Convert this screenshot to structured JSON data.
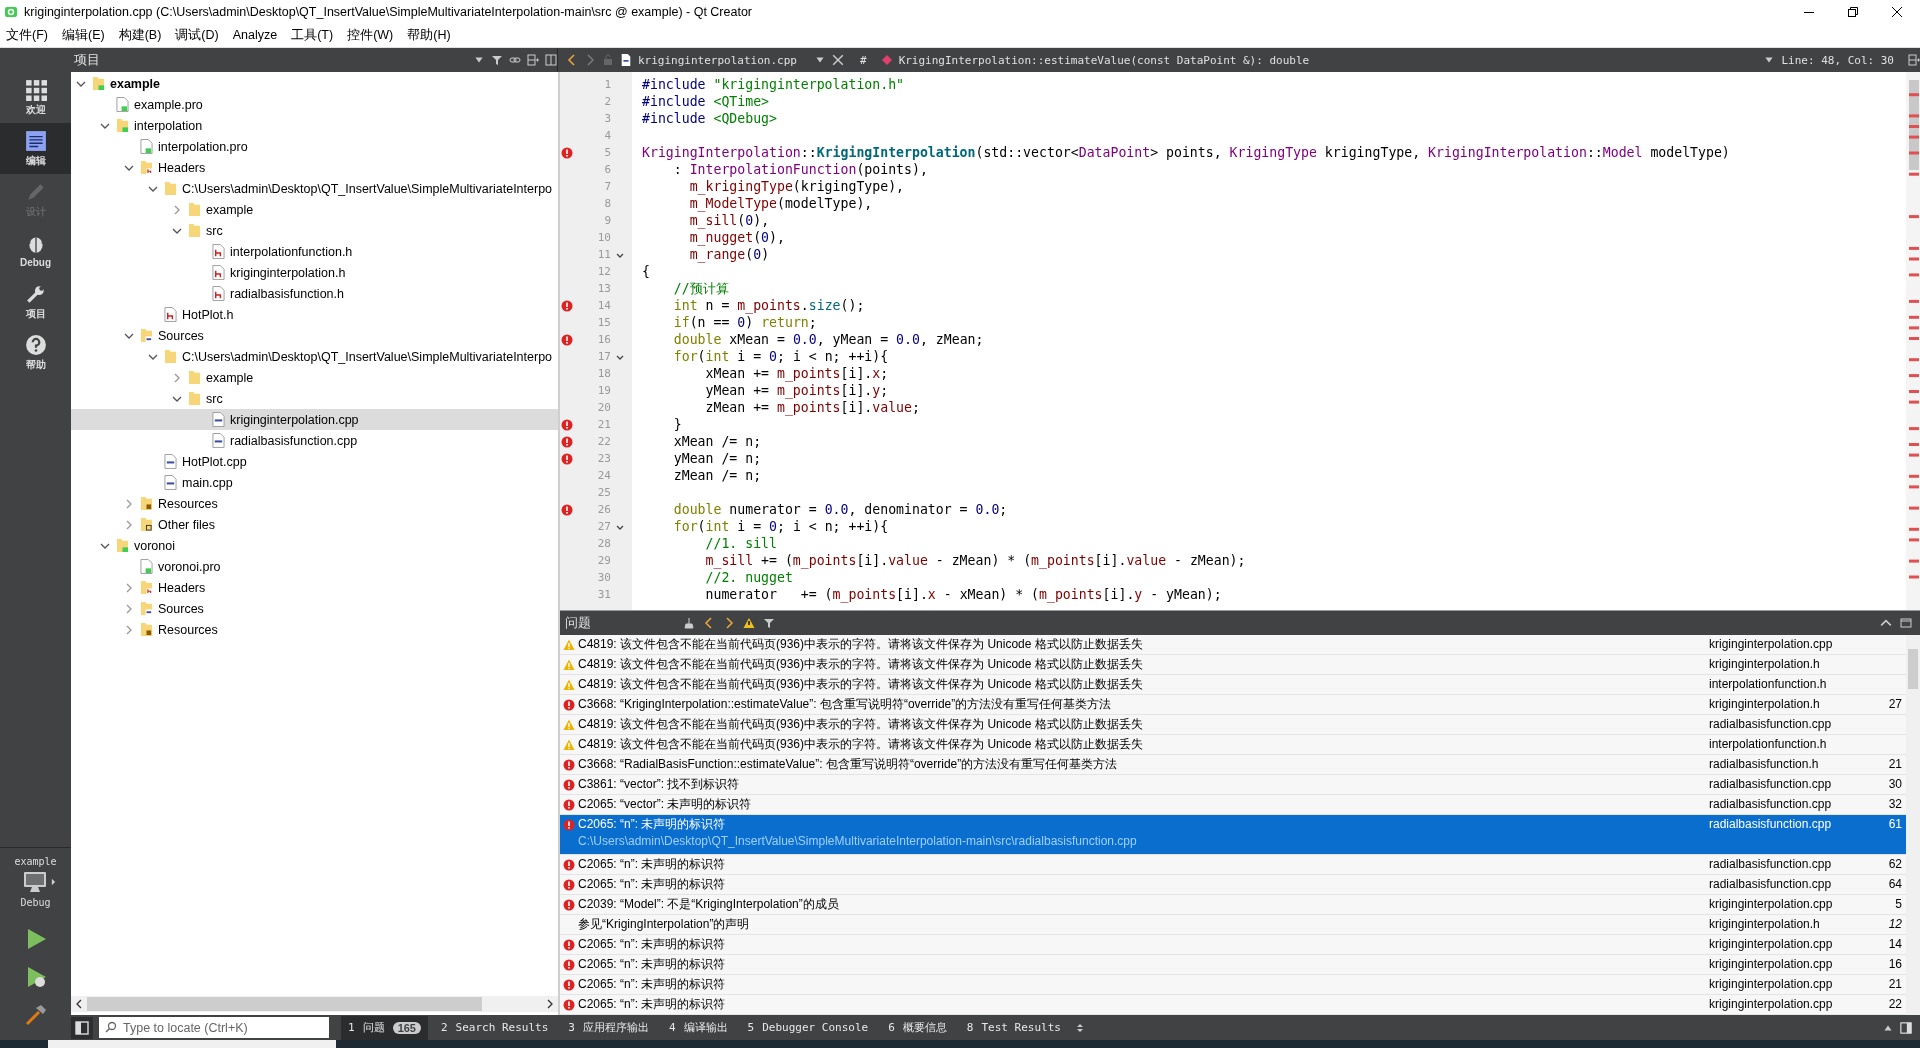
{
  "window": {
    "title": "kriginginterpolation.cpp (C:\\Users\\admin\\Desktop\\QT_InsertValue\\SimpleMultivariateInterpolation-main\\src @ example) - Qt Creator"
  },
  "menu": [
    "文件(F)",
    "编辑(E)",
    "构建(B)",
    "调试(D)",
    "Analyze",
    "工具(T)",
    "控件(W)",
    "帮助(H)"
  ],
  "modes": [
    {
      "label": "欢迎",
      "kind": "welcome",
      "selected": false,
      "disabled": false
    },
    {
      "label": "编辑",
      "kind": "edit",
      "selected": true,
      "disabled": false
    },
    {
      "label": "设计",
      "kind": "design",
      "selected": false,
      "disabled": true
    },
    {
      "label": "Debug",
      "kind": "debug",
      "selected": false,
      "disabled": false
    },
    {
      "label": "项目",
      "kind": "projects",
      "selected": false,
      "disabled": false
    },
    {
      "label": "帮助",
      "kind": "help",
      "selected": false,
      "disabled": false
    }
  ],
  "kit": {
    "project": "example",
    "build": "Debug"
  },
  "project_pane": {
    "title": "项目"
  },
  "tree": [
    {
      "label": "example",
      "kind": "project",
      "bold": true,
      "selected": false,
      "expanded": true,
      "children": [
        {
          "label": "example.pro",
          "kind": "pro",
          "selected": false
        },
        {
          "label": "interpolation",
          "kind": "project",
          "selected": false,
          "expanded": true,
          "children": [
            {
              "label": "interpolation.pro",
              "kind": "pro",
              "selected": false
            },
            {
              "label": "Headers",
              "kind": "header-folder",
              "selected": false,
              "expanded": true,
              "children": [
                {
                  "label": "C:\\Users\\admin\\Desktop\\QT_InsertValue\\SimpleMultivariateInterpo",
                  "kind": "folder",
                  "selected": false,
                  "expanded": true,
                  "children": [
                    {
                      "label": "example",
                      "kind": "folder",
                      "selected": false,
                      "expanded": false
                    },
                    {
                      "label": "src",
                      "kind": "folder",
                      "selected": false,
                      "expanded": true,
                      "children": [
                        {
                          "label": "interpolationfunction.h",
                          "kind": "h",
                          "selected": false
                        },
                        {
                          "label": "kriginginterpolation.h",
                          "kind": "h",
                          "selected": false
                        },
                        {
                          "label": "radialbasisfunction.h",
                          "kind": "h",
                          "selected": false
                        }
                      ]
                    }
                  ]
                },
                {
                  "label": "HotPlot.h",
                  "kind": "h",
                  "selected": false
                }
              ]
            },
            {
              "label": "Sources",
              "kind": "source-folder",
              "selected": false,
              "expanded": true,
              "children": [
                {
                  "label": "C:\\Users\\admin\\Desktop\\QT_InsertValue\\SimpleMultivariateInterpo",
                  "kind": "folder",
                  "selected": false,
                  "expanded": true,
                  "children": [
                    {
                      "label": "example",
                      "kind": "folder",
                      "selected": false,
                      "expanded": false
                    },
                    {
                      "label": "src",
                      "kind": "folder",
                      "selected": false,
                      "expanded": true,
                      "children": [
                        {
                          "label": "kriginginterpolation.cpp",
                          "kind": "cpp",
                          "selected": true
                        },
                        {
                          "label": "radialbasisfunction.cpp",
                          "kind": "cpp",
                          "selected": false
                        }
                      ]
                    }
                  ]
                },
                {
                  "label": "HotPlot.cpp",
                  "kind": "cpp",
                  "selected": false
                },
                {
                  "label": "main.cpp",
                  "kind": "cpp",
                  "selected": false
                }
              ]
            },
            {
              "label": "Resources",
              "kind": "resource-folder",
              "selected": false,
              "expanded": false
            },
            {
              "label": "Other files",
              "kind": "other-folder",
              "selected": false,
              "expanded": false
            }
          ]
        },
        {
          "label": "voronoi",
          "kind": "project",
          "selected": false,
          "expanded": true,
          "children": [
            {
              "label": "voronoi.pro",
              "kind": "pro",
              "selected": false
            },
            {
              "label": "Headers",
              "kind": "header-folder",
              "selected": false,
              "expanded": false
            },
            {
              "label": "Sources",
              "kind": "source-folder",
              "selected": false,
              "expanded": false
            },
            {
              "label": "Resources",
              "kind": "resource-folder",
              "selected": false,
              "expanded": false
            }
          ]
        }
      ]
    }
  ],
  "editor_toolbar": {
    "file": "kriginginterpolation.cpp",
    "hash": "#",
    "symbol": "KrigingInterpolation::estimateValue(const DataPoint &): double",
    "position": "Line: 48, Col: 30"
  },
  "code": [
    {
      "n": "1",
      "segs": [
        {
          "kind": "pp",
          "text": "#include "
        },
        {
          "kind": "str",
          "text": "\"kriginginterpolation.h\""
        }
      ]
    },
    {
      "n": "2",
      "segs": [
        {
          "kind": "pp",
          "text": "#include "
        },
        {
          "kind": "str",
          "text": "<QTime>"
        }
      ]
    },
    {
      "n": "3",
      "segs": [
        {
          "kind": "pp",
          "text": "#include "
        },
        {
          "kind": "str",
          "text": "<QDebug>"
        }
      ]
    },
    {
      "n": "4"
    },
    {
      "n": "5",
      "error": true,
      "segs": [
        {
          "kind": "type",
          "text": "KrigingInterpolation"
        },
        {
          "kind": "p",
          "text": "::"
        },
        {
          "kind": "bold",
          "text": "KrigingInterpolation"
        },
        {
          "kind": "p",
          "text": "(std::vector<"
        },
        {
          "kind": "type",
          "text": "DataPoint"
        },
        {
          "kind": "p",
          "text": "> points, "
        },
        {
          "kind": "type",
          "text": "KrigingType"
        },
        {
          "kind": "p",
          "text": " krigingType, "
        },
        {
          "kind": "type",
          "text": "KrigingInterpolation"
        },
        {
          "kind": "p",
          "text": "::"
        },
        {
          "kind": "type",
          "text": "Model"
        },
        {
          "kind": "p",
          "text": " modelType)"
        }
      ]
    },
    {
      "n": "6",
      "segs": [
        {
          "kind": "p",
          "text": "    : "
        },
        {
          "kind": "type",
          "text": "InterpolationFunction"
        },
        {
          "kind": "p",
          "text": "(points),"
        }
      ]
    },
    {
      "n": "7",
      "segs": [
        {
          "kind": "field",
          "text": "      m_krigingType"
        },
        {
          "kind": "p",
          "text": "(krigingType),"
        }
      ]
    },
    {
      "n": "8",
      "segs": [
        {
          "kind": "field",
          "text": "      m_ModelType"
        },
        {
          "kind": "p",
          "text": "(modelType),"
        }
      ]
    },
    {
      "n": "9",
      "segs": [
        {
          "kind": "field",
          "text": "      m_sill"
        },
        {
          "kind": "p",
          "text": "("
        },
        {
          "kind": "num",
          "text": "0"
        },
        {
          "kind": "p",
          "text": "),"
        }
      ]
    },
    {
      "n": "10",
      "segs": [
        {
          "kind": "field",
          "text": "      m_nugget"
        },
        {
          "kind": "p",
          "text": "("
        },
        {
          "kind": "num",
          "text": "0"
        },
        {
          "kind": "p",
          "text": "),"
        }
      ]
    },
    {
      "n": "11",
      "fold": true,
      "segs": [
        {
          "kind": "field",
          "text": "      m_range"
        },
        {
          "kind": "p",
          "text": "("
        },
        {
          "kind": "num",
          "text": "0"
        },
        {
          "kind": "p",
          "text": ")"
        }
      ]
    },
    {
      "n": "12",
      "segs": [
        {
          "kind": "p",
          "text": "{"
        }
      ]
    },
    {
      "n": "13",
      "segs": [
        {
          "kind": "cm",
          "text": "    //预计算"
        }
      ]
    },
    {
      "n": "14",
      "error": true,
      "segs": [
        {
          "kind": "kw",
          "text": "    int"
        },
        {
          "kind": "p",
          "text": " n = "
        },
        {
          "kind": "field",
          "text": "m_points"
        },
        {
          "kind": "p",
          "text": "."
        },
        {
          "kind": "fn",
          "text": "size"
        },
        {
          "kind": "p",
          "text": "();"
        }
      ]
    },
    {
      "n": "15",
      "segs": [
        {
          "kind": "kw",
          "text": "    if"
        },
        {
          "kind": "p",
          "text": "(n == "
        },
        {
          "kind": "num",
          "text": "0"
        },
        {
          "kind": "p",
          "text": ") "
        },
        {
          "kind": "kw",
          "text": "return"
        },
        {
          "kind": "p",
          "text": ";"
        }
      ]
    },
    {
      "n": "16",
      "error": true,
      "segs": [
        {
          "kind": "kw",
          "text": "    double"
        },
        {
          "kind": "p",
          "text": " xMean = "
        },
        {
          "kind": "num",
          "text": "0.0"
        },
        {
          "kind": "p",
          "text": ", yMean = "
        },
        {
          "kind": "num",
          "text": "0.0"
        },
        {
          "kind": "p",
          "text": ", zMean;"
        }
      ]
    },
    {
      "n": "17",
      "fold": true,
      "segs": [
        {
          "kind": "kw",
          "text": "    for"
        },
        {
          "kind": "p",
          "text": "("
        },
        {
          "kind": "kw",
          "text": "int"
        },
        {
          "kind": "p",
          "text": " i = "
        },
        {
          "kind": "num",
          "text": "0"
        },
        {
          "kind": "p",
          "text": "; i < n; ++i){"
        }
      ]
    },
    {
      "n": "18",
      "segs": [
        {
          "kind": "p",
          "text": "        xMean += "
        },
        {
          "kind": "field",
          "text": "m_points"
        },
        {
          "kind": "p",
          "text": "[i]."
        },
        {
          "kind": "field",
          "text": "x"
        },
        {
          "kind": "p",
          "text": ";"
        }
      ]
    },
    {
      "n": "19",
      "segs": [
        {
          "kind": "p",
          "text": "        yMean += "
        },
        {
          "kind": "field",
          "text": "m_points"
        },
        {
          "kind": "p",
          "text": "[i]."
        },
        {
          "kind": "field",
          "text": "y"
        },
        {
          "kind": "p",
          "text": ";"
        }
      ]
    },
    {
      "n": "20",
      "segs": [
        {
          "kind": "p",
          "text": "        zMean += "
        },
        {
          "kind": "field",
          "text": "m_points"
        },
        {
          "kind": "p",
          "text": "[i]."
        },
        {
          "kind": "field",
          "text": "value"
        },
        {
          "kind": "p",
          "text": ";"
        }
      ]
    },
    {
      "n": "21",
      "error": true,
      "segs": [
        {
          "kind": "p",
          "text": "    }"
        }
      ]
    },
    {
      "n": "22",
      "error": true,
      "segs": [
        {
          "kind": "p",
          "text": "    xMean /= n;"
        }
      ]
    },
    {
      "n": "23",
      "error": true,
      "segs": [
        {
          "kind": "p",
          "text": "    yMean /= n;"
        }
      ]
    },
    {
      "n": "24",
      "segs": [
        {
          "kind": "p",
          "text": "    zMean /= n;"
        }
      ]
    },
    {
      "n": "25"
    },
    {
      "n": "26",
      "error": true,
      "segs": [
        {
          "kind": "kw",
          "text": "    double"
        },
        {
          "kind": "p",
          "text": " numerator = "
        },
        {
          "kind": "num",
          "text": "0.0"
        },
        {
          "kind": "p",
          "text": ", denominator = "
        },
        {
          "kind": "num",
          "text": "0.0"
        },
        {
          "kind": "p",
          "text": ";"
        }
      ]
    },
    {
      "n": "27",
      "fold": true,
      "segs": [
        {
          "kind": "kw",
          "text": "    for"
        },
        {
          "kind": "p",
          "text": "("
        },
        {
          "kind": "kw",
          "text": "int"
        },
        {
          "kind": "p",
          "text": " i = "
        },
        {
          "kind": "num",
          "text": "0"
        },
        {
          "kind": "p",
          "text": "; i < n; ++i){"
        }
      ]
    },
    {
      "n": "28",
      "segs": [
        {
          "kind": "cm",
          "text": "        //1. sill"
        }
      ]
    },
    {
      "n": "29",
      "segs": [
        {
          "kind": "field",
          "text": "        m_sill"
        },
        {
          "kind": "p",
          "text": " += ("
        },
        {
          "kind": "field",
          "text": "m_points"
        },
        {
          "kind": "p",
          "text": "[i]."
        },
        {
          "kind": "field",
          "text": "value"
        },
        {
          "kind": "p",
          "text": " - zMean) * ("
        },
        {
          "kind": "field",
          "text": "m_points"
        },
        {
          "kind": "p",
          "text": "[i]."
        },
        {
          "kind": "field",
          "text": "value"
        },
        {
          "kind": "p",
          "text": " - zMean);"
        }
      ]
    },
    {
      "n": "30",
      "segs": [
        {
          "kind": "cm",
          "text": "        //2. nugget"
        }
      ]
    },
    {
      "n": "31",
      "segs": [
        {
          "kind": "p",
          "text": "        numerator   += ("
        },
        {
          "kind": "field",
          "text": "m_points"
        },
        {
          "kind": "p",
          "text": "[i]."
        },
        {
          "kind": "field",
          "text": "x"
        },
        {
          "kind": "p",
          "text": " - xMean) * ("
        },
        {
          "kind": "field",
          "text": "m_points"
        },
        {
          "kind": "p",
          "text": "[i]."
        },
        {
          "kind": "field",
          "text": "y"
        },
        {
          "kind": "p",
          "text": " - yMean);"
        }
      ]
    }
  ],
  "issues": {
    "title": "问题",
    "rows": [
      {
        "kind": "warning",
        "text": "C4819: 该文件包含不能在当前代码页(936)中表示的字符。请将该文件保存为 Unicode 格式以防止数据丢失",
        "file": "kriginginterpolation.cpp",
        "selected": false
      },
      {
        "kind": "warning",
        "text": "C4819: 该文件包含不能在当前代码页(936)中表示的字符。请将该文件保存为 Unicode 格式以防止数据丢失",
        "file": "kriginginterpolation.h",
        "selected": false
      },
      {
        "kind": "warning",
        "text": "C4819: 该文件包含不能在当前代码页(936)中表示的字符。请将该文件保存为 Unicode 格式以防止数据丢失",
        "file": "interpolationfunction.h",
        "selected": false
      },
      {
        "kind": "error",
        "text": "C3668: “KrigingInterpolation::estimateValue”: 包含重写说明符“override”的方法没有重写任何基类方法",
        "file": "kriginginterpolation.h",
        "line": "27",
        "selected": false
      },
      {
        "kind": "warning",
        "text": "C4819: 该文件包含不能在当前代码页(936)中表示的字符。请将该文件保存为 Unicode 格式以防止数据丢失",
        "file": "radialbasisfunction.cpp",
        "selected": false
      },
      {
        "kind": "warning",
        "text": "C4819: 该文件包含不能在当前代码页(936)中表示的字符。请将该文件保存为 Unicode 格式以防止数据丢失",
        "file": "interpolationfunction.h",
        "selected": false
      },
      {
        "kind": "error",
        "text": "C3668: “RadialBasisFunction::estimateValue”: 包含重写说明符“override”的方法没有重写任何基类方法",
        "file": "radialbasisfunction.h",
        "line": "21",
        "selected": false
      },
      {
        "kind": "error",
        "text": "C3861: “vector”: 找不到标识符",
        "file": "radialbasisfunction.cpp",
        "line": "30",
        "selected": false
      },
      {
        "kind": "error",
        "text": "C2065: “vector”: 未声明的标识符",
        "file": "radialbasisfunction.cpp",
        "line": "32",
        "selected": false
      },
      {
        "kind": "error",
        "text": "C2065: “n”: 未声明的标识符",
        "path": "C:\\Users\\admin\\Desktop\\QT_InsertValue\\SimpleMultivariateInterpolation-main\\src\\radialbasisfunction.cpp",
        "file": "radialbasisfunction.cpp",
        "line": "61",
        "selected": true
      },
      {
        "kind": "error",
        "text": "C2065: “n”: 未声明的标识符",
        "file": "radialbasisfunction.cpp",
        "line": "62",
        "selected": false
      },
      {
        "kind": "error",
        "text": "C2065: “n”: 未声明的标识符",
        "file": "radialbasisfunction.cpp",
        "line": "64",
        "selected": false
      },
      {
        "kind": "error",
        "text": "C2039: “Model”: 不是“KrigingInterpolation”的成员",
        "file": "kriginginterpolation.cpp",
        "line": "5",
        "selected": false
      },
      {
        "kind": "note",
        "text": "参见“KrigingInterpolation”的声明",
        "file": "kriginginterpolation.h",
        "line": "12",
        "selected": false
      },
      {
        "kind": "error",
        "text": "C2065: “n”: 未声明的标识符",
        "file": "kriginginterpolation.cpp",
        "line": "14",
        "selected": false
      },
      {
        "kind": "error",
        "text": "C2065: “n”: 未声明的标识符",
        "file": "kriginginterpolation.cpp",
        "line": "16",
        "selected": false
      },
      {
        "kind": "error",
        "text": "C2065: “n”: 未声明的标识符",
        "file": "kriginginterpolation.cpp",
        "line": "21",
        "selected": false
      },
      {
        "kind": "error",
        "text": "C2065: “n”: 未声明的标识符",
        "file": "kriginginterpolation.cpp",
        "line": "22",
        "selected": false
      }
    ]
  },
  "locator": {
    "placeholder": "Type to locate (Ctrl+K)"
  },
  "output_tabs": [
    {
      "num": "1",
      "label": "问题",
      "badge": "165",
      "selected": true
    },
    {
      "num": "2",
      "label": "Search Results",
      "selected": false
    },
    {
      "num": "3",
      "label": "应用程序输出",
      "selected": false
    },
    {
      "num": "4",
      "label": "编译输出",
      "selected": false
    },
    {
      "num": "5",
      "label": "Debugger Console",
      "selected": false
    },
    {
      "num": "6",
      "label": "概要信息",
      "selected": false
    },
    {
      "num": "8",
      "label": "Test Results",
      "selected": false
    }
  ]
}
